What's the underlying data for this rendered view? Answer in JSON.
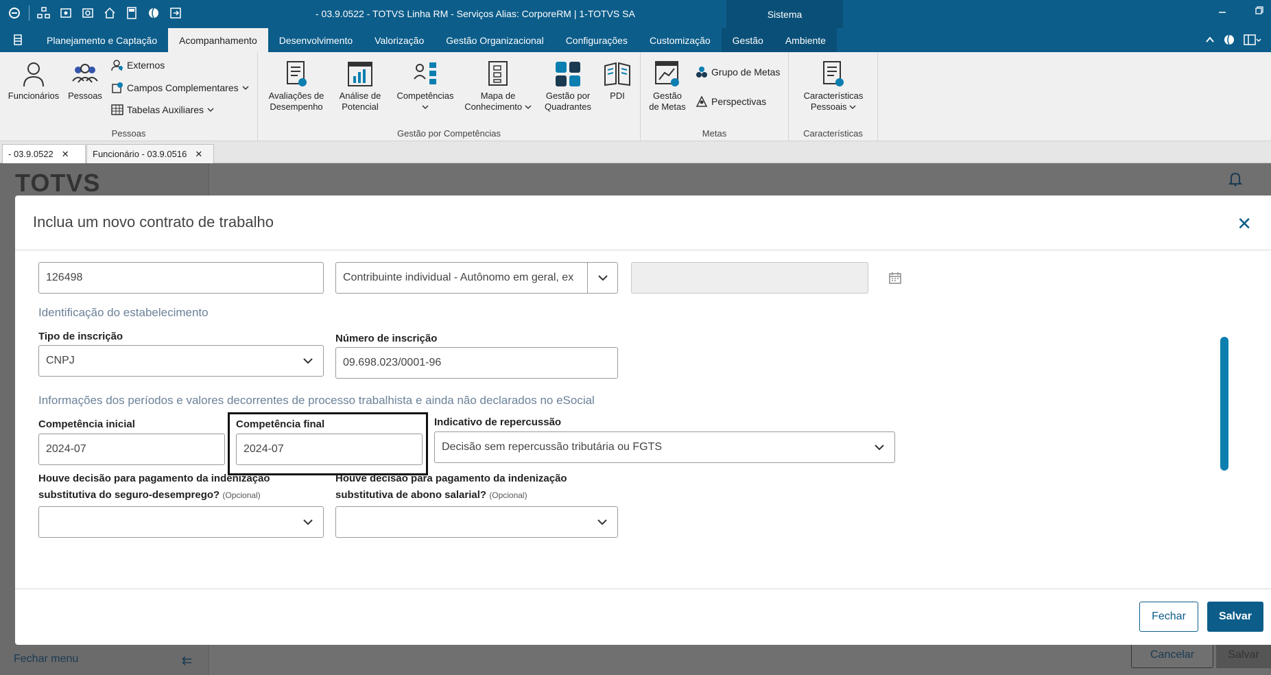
{
  "window": {
    "title": "- 03.9.0522 - TOTVS Linha RM - Serviços  Alias: CorporeRM | 1-TOTVS SA",
    "sistema_label": "Sistema"
  },
  "ribbon_tabs": [
    "Planejamento e Captação",
    "Acompanhamento",
    "Desenvolvimento",
    "Valorização",
    "Gestão Organizacional",
    "Configurações",
    "Customização",
    "Gestão",
    "Ambiente"
  ],
  "ribbon": {
    "pessoas": {
      "label": "Pessoas",
      "funcionarios": "Funcionários",
      "pessoas": "Pessoas",
      "externos": "Externos",
      "campos": "Campos Complementares",
      "tabelas": "Tabelas Auxiliares"
    },
    "competencias_group": {
      "label": "Gestão por Competências",
      "avaliacoes_1": "Avaliações de",
      "avaliacoes_2": "Desempenho",
      "analise_1": "Análise de",
      "analise_2": "Potencial",
      "competencias": "Competências",
      "mapa_1": "Mapa de",
      "mapa_2": "Conhecimento",
      "quadrantes_1": "Gestão por",
      "quadrantes_2": "Quadrantes",
      "pdi": "PDI"
    },
    "metas": {
      "label": "Metas",
      "gestao_1": "Gestão",
      "gestao_2": "de Metas",
      "grupo": "Grupo de Metas",
      "perspectivas": "Perspectivas"
    },
    "caracteristicas": {
      "label": "Características",
      "btn_1": "Características",
      "btn_2": "Pessoais"
    }
  },
  "doc_tabs": [
    "- 03.9.0522",
    "Funcionário - 03.9.0516"
  ],
  "background": {
    "logo": "TOTVS",
    "fechar_menu": "Fechar menu",
    "cancelar": "Cancelar",
    "salvar": "Salvar"
  },
  "modal": {
    "title": "Inclua um novo contrato de trabalho",
    "fields": {
      "matricula_value": "126498",
      "categoria_value": "Contribuinte individual - Autônomo em geral, ex",
      "data_value": "",
      "section_estabelecimento": "Identificação do estabelecimento",
      "tipo_inscricao_label": "Tipo de inscrição",
      "tipo_inscricao_value": "CNPJ",
      "numero_inscricao_label": "Número de inscrição",
      "numero_inscricao_value": "09.698.023/0001-96",
      "section_periodos": "Informações dos períodos e valores decorrentes de processo trabalhista e ainda não declarados no eSocial",
      "comp_inicial_label": "Competência inicial",
      "comp_inicial_value": "2024-07",
      "comp_final_label": "Competência final",
      "comp_final_value": "2024-07",
      "repercussao_label": "Indicativo de repercussão",
      "repercussao_value": "Decisão sem repercussão tributária ou FGTS",
      "seguro_label_1": "Houve decisão para pagamento da indenização",
      "seguro_label_2": "substitutiva do seguro-desemprego?",
      "abono_label_1": "Houve decisão para pagamento da indenização",
      "abono_label_2": "substitutiva de abono salarial?",
      "opcional": "(Opcional)"
    },
    "buttons": {
      "fechar": "Fechar",
      "salvar": "Salvar"
    }
  },
  "colors": {
    "brand": "#0c5d8a",
    "accent": "#0c7fb0"
  }
}
